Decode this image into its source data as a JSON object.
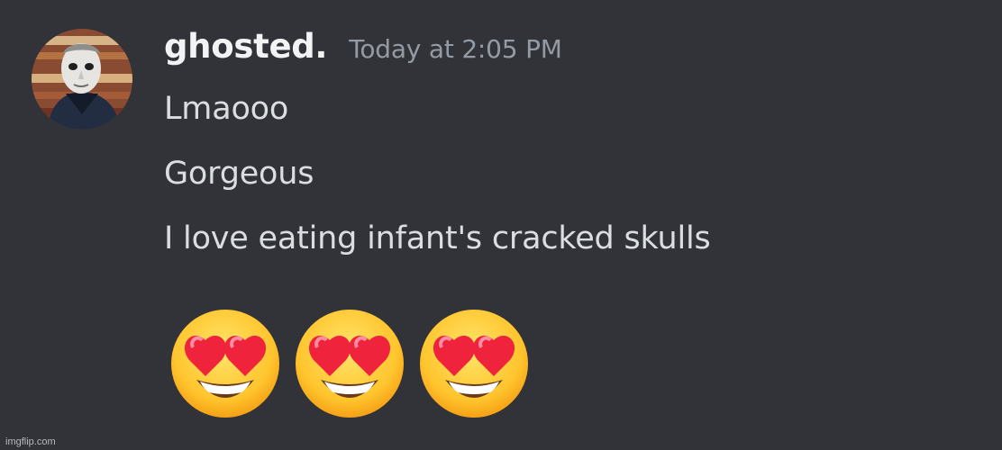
{
  "message": {
    "author": "ghosted.",
    "timestamp": "Today at 2:05 PM",
    "avatar_icon": "masked-figure-avatar",
    "lines": [
      "Lmaooo",
      "Gorgeous",
      "I love eating infant's cracked skulls"
    ],
    "emojis": [
      "smiling-face-with-heart-eyes",
      "smiling-face-with-heart-eyes",
      "smiling-face-with-heart-eyes"
    ]
  },
  "watermark": "imgflip.com",
  "colors": {
    "background": "#313338",
    "username": "#f2f3f5",
    "timestamp": "#949ba4",
    "message_text": "#dbdee1"
  }
}
